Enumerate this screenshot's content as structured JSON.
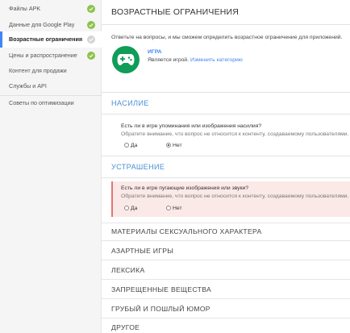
{
  "sidebar": {
    "items": [
      {
        "label": "Файлы APK",
        "status": "done"
      },
      {
        "label": "Данные для Google Play",
        "status": "done"
      },
      {
        "label": "Возрастные ограничения",
        "status": "todo",
        "active": true
      },
      {
        "label": "Цены и распространение",
        "status": "done"
      },
      {
        "label": "Контент для продажи"
      },
      {
        "label": "Службы и API"
      }
    ],
    "footer_item": "Советы по оптимизации"
  },
  "main": {
    "title": "ВОЗРАСТНЫЕ ОГРАНИЧЕНИЯ",
    "intro": "Ответьте на вопросы, и мы сможем определить возрастное ограничение для приложений.",
    "category": {
      "name": "ИГРА",
      "desc": "Является игрой.",
      "change_link": "Изменить категорию",
      "icon": "gamepad-icon"
    },
    "sections": [
      {
        "heading": "НАСИЛИЕ",
        "question": "Есть ли в игре упоминания или изображения насилия?",
        "note": "Обратите внимание, что вопрос не относится к контенту, создаваемому пользователями.",
        "options": [
          "Да",
          "Нет"
        ],
        "selected": "Нет"
      },
      {
        "heading": "УСТРАШЕНИЕ",
        "question": "Есть ли в игре пугающие изображения или звуки?",
        "note": "Обратите внимание, что вопрос не относится к контенту, создаваемому пользователями.",
        "options": [
          "Да",
          "Нет"
        ],
        "selected": null
      }
    ],
    "collapsed_sections": [
      "МАТЕРИАЛЫ СЕКСУАЛЬНОГО ХАРАКТЕРА",
      "АЗАРТНЫЕ ИГРЫ",
      "ЛЕКСИКА",
      "ЗАПРЕЩЕННЫЕ ВЕЩЕСТВА",
      "ГРУБЫЙ И ПОШЛЫЙ ЮМОР",
      "ДРУГОЕ"
    ]
  },
  "colors": {
    "accent": "#4285f4",
    "section_heading": "#4a90d9",
    "done": "#8bc34a",
    "game_icon_bg": "#0f9d58",
    "warning_bg": "#fbe9e7"
  }
}
